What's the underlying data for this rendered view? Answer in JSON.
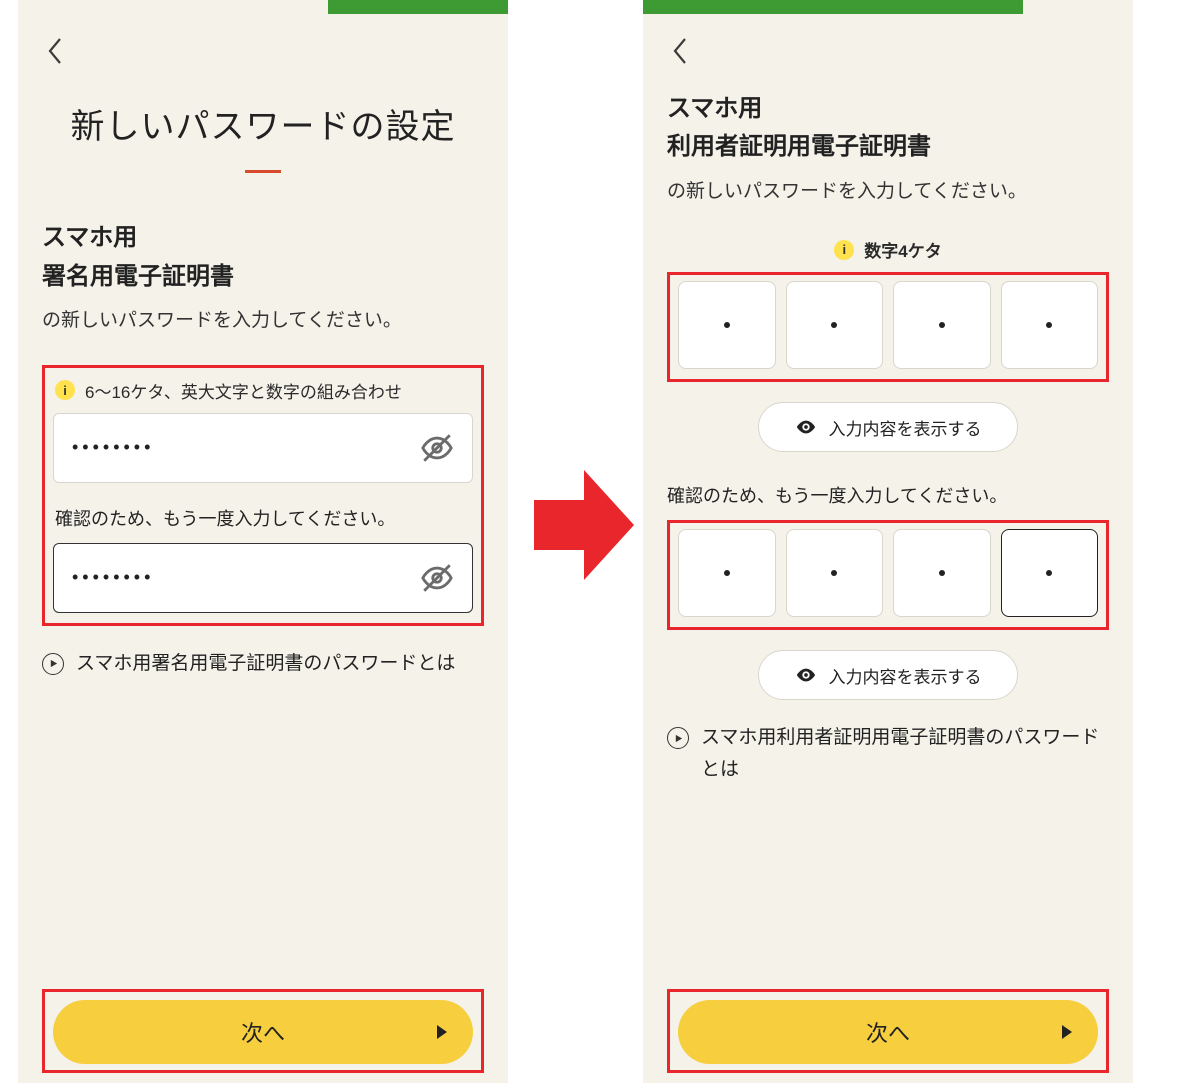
{
  "left": {
    "title": "新しいパスワードの設定",
    "subhead_line1": "スマホ用",
    "subhead_line2": "署名用電子証明書",
    "subcopy": "の新しいパスワードを入力してください。",
    "info_hint": "6〜16ケタ、英大文字と数字の組み合わせ",
    "password_mask": "••••••••",
    "confirm_label": "確認のため、もう一度入力してください。",
    "confirm_mask": "••••••••",
    "help_link": "スマホ用署名用電子証明書のパスワードとは",
    "next_label": "次へ"
  },
  "right": {
    "subhead_line1": "スマホ用",
    "subhead_line2": "利用者証明用電子証明書",
    "subcopy": "の新しいパスワードを入力してください。",
    "info_hint": "数字4ケタ",
    "show_toggle": "入力内容を表示する",
    "confirm_label": "確認のため、もう一度入力してください。",
    "help_link": "スマホ用利用者証明用電子証明書のパスワードとは",
    "next_label": "次へ"
  },
  "icons": {
    "back": "chevron-left-icon",
    "info": "info-icon",
    "eye_off": "eye-off-icon",
    "eye": "eye-icon",
    "play": "circle-play-icon",
    "arrow": "red-arrow-icon",
    "tri": "triangle-right-icon"
  }
}
